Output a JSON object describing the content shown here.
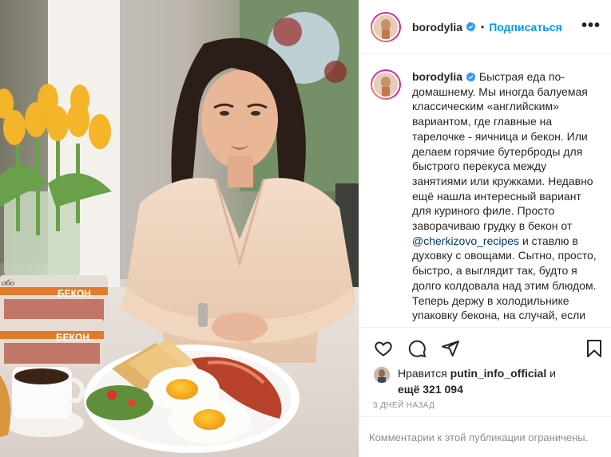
{
  "post": {
    "username": "borodylia",
    "follow_label": "Подписаться",
    "separator": "•",
    "more_label": "•••"
  },
  "caption": {
    "username": "borodylia",
    "text_before_mention": "Быстрая еда по-домашнему. Мы иногда балуемая классическим «английским» вариантом, где главные на тарелочке - яичница и бекон. Или делаем горячие бутерброды для быстрого перекуса между занятиями или кружками. Недавно ещё нашла интересный вариант для куриного филе. Просто заворачиваю грудку в бекон от",
    "mention": "@cherkizovo_recipes",
    "text_after_mention": "и ставлю в духовку с овощами. Сытно, просто, быстро, а выглядит так, будто я долго колдовала над этим блюдом. Теперь держу в холодильнике упаковку бекона, на случай, если нужно накормить и удивить домашних))"
  },
  "likes": {
    "prefix": "Нравится",
    "liker": "putin_info_official",
    "joiner": "и",
    "others": "ещё 321 094"
  },
  "timestamp": "3 дней назад",
  "comments_notice": "Комментарии к этой публикации ограничены.",
  "photo": {
    "package_label_1": "БЕКОН",
    "package_label_2": "БЕКОН",
    "brand_fragment": "обо"
  },
  "icons": {
    "verified": "verified-badge-icon",
    "like": "heart-icon",
    "comment": "comment-bubble-icon",
    "share": "paper-plane-icon",
    "save": "bookmark-icon"
  },
  "colors": {
    "link": "#0095f6",
    "mention": "#00376b",
    "muted": "#8e8e8e",
    "text": "#262626",
    "border": "#efefef"
  }
}
